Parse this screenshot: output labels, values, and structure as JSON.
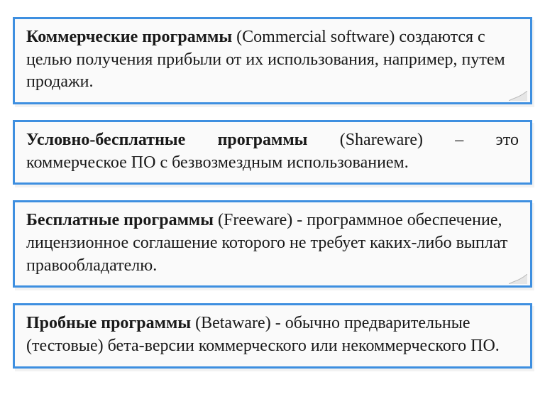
{
  "cards": [
    {
      "term": "Коммерческие программы",
      "paren": " (Commercial software) ",
      "rest": "создаются с целью получения прибыли от их использования, например, путем продажи."
    },
    {
      "line1_term": "Условно-бесплатные программы",
      "line1_mid": " (Shareware) – это",
      "line2": "коммерческое ПО с безвозмездным использованием."
    },
    {
      "term": "Бесплатные программы",
      "paren": " (Freeware) - ",
      "rest": "программное обеспечение, лицензионное соглашение которого не требует каких-либо выплат правообладателю."
    },
    {
      "term": "Пробные программы",
      "paren": " (Betaware) - ",
      "rest": "обычно предварительные (тестовые) бета-версии коммерческого или некоммерческого ПО."
    }
  ]
}
